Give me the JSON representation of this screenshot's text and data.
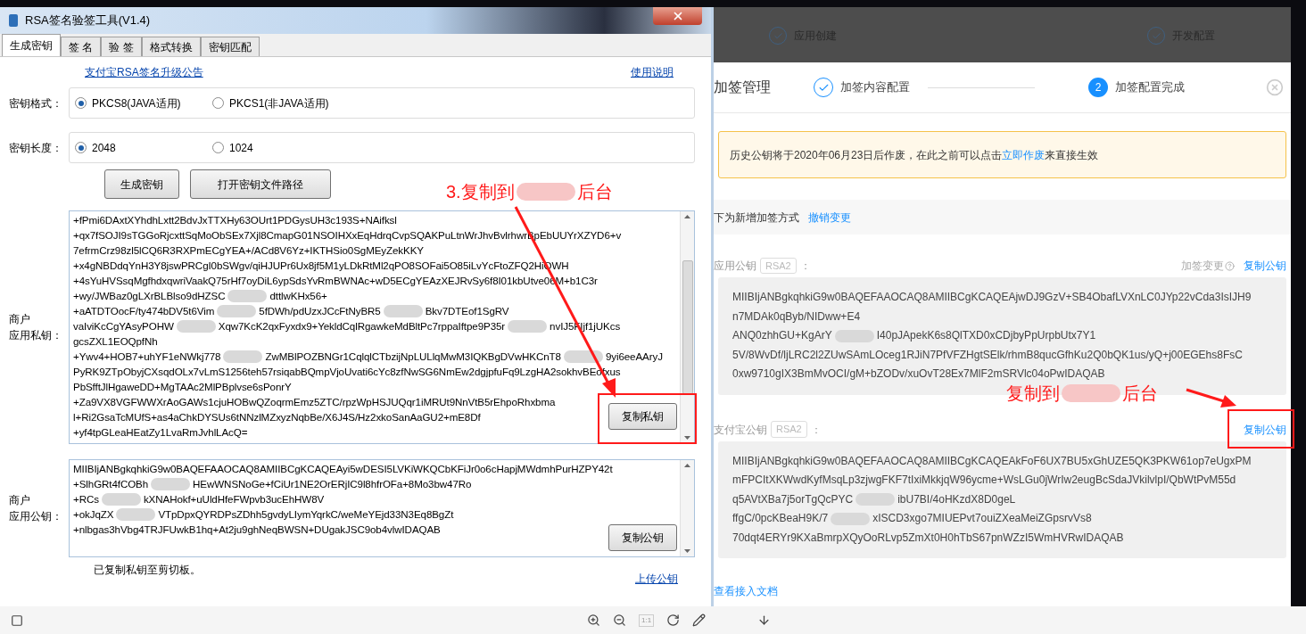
{
  "app_window": {
    "title": "RSA签名验签工具(V1.4)",
    "tabs": [
      {
        "label": "生成密钥",
        "selected": true
      },
      {
        "label": "签 名",
        "selected": false
      },
      {
        "label": "验 签",
        "selected": false
      },
      {
        "label": "格式转换",
        "selected": false
      },
      {
        "label": "密钥匹配",
        "selected": false
      }
    ],
    "links": [
      "支付宝RSA签名升级公告",
      "使用说明"
    ],
    "key_format": {
      "label": "密钥格式：",
      "options": [
        {
          "label": "PKCS8(JAVA适用)",
          "selected": true
        },
        {
          "label": "PKCS1(非JAVA适用)",
          "selected": false
        }
      ]
    },
    "key_length": {
      "label": "密钥长度：",
      "options": [
        {
          "label": "2048",
          "selected": true
        },
        {
          "label": "1024",
          "selected": false
        }
      ]
    },
    "buttons": [
      "生成密钥",
      "打开密钥文件路径"
    ],
    "private_key": {
      "label_lines": [
        "商户",
        "应用私钥："
      ],
      "button": "复制私钥",
      "lines": [
        [
          "+fPmi6DAxtXYhdhLxtt2BdvJxTTXHy63OUrt1PDGysUH3c193S+NAifksl"
        ],
        [
          "+qx7fSOJI9sTGGoRjcxttSqMoObSEx7Xjl8CmapG01NSOIHXxEqHdrqCvpSQAKPuLtnWrJhvBvlrhwrBpEbUUYrXZYD6+v"
        ],
        [
          "7efrmCrz98zl5lCQ6R3RXPmECgYEA+/ACd8V6Yz+IKTHSio0SgMEyZekKKY"
        ],
        [
          "+x4gNBDdqYnH3Y8jswPRCgI0bSWgv/qiHJUPr6Ux8jf5M1yLDkRtMl2qPO8SOFai5O85iLvYcFtoZFQ2HiQWH"
        ],
        [
          "+4sYuHVSsqMgfhdxqwriVaakQ75rHf7oyDiL6ypSdsYvRmBWNAc+wD5ECgYEAzXEJRvSy6f8I01kbUtve06M+b1C3r"
        ],
        [
          "+wy/JWBaz0gLXrBLBlso9dHZSC",
          "dttlwKHx56+"
        ],
        [
          "+aATDTOocF/ty474bDV5t6Vim",
          "5fDWh/pdUzxJCcFtNyBR5",
          "Bkv7DTEof1SgRV"
        ],
        [
          "vaIviKcCgYAsyPOHW",
          "Xqw7KcK2qxFyxdx9+YekldCqlRgawkeMdBltPc7rppaIftpe9P35r",
          "nvIJ5FIjf1jUKcs"
        ],
        [
          "gcsZXL1EOQpfNh"
        ],
        [
          "+Ywv4+HOB7+uhYF1eNWkj778",
          "ZwMBlPOZBNGr1CqlqlCTbzijNpLULlqMwM3IQKBgDVwHKCnT8",
          "9yi6eeAAryJ"
        ],
        [
          "PyRK9ZTpObyjCXsqdOLx7vLmS1256teh57rsiqabBQmpVjoUvati6cYc8zfNwSG6NmEw2dgjpfuFq9LzgHA2sokhvBEofxus"
        ],
        [
          "PbSfftJlHgaweDD+MgTAAc2MlPBplvse6sPonrY"
        ],
        [
          "+Za9VX8VGFWWXrAoGAWs1cjuHOBwQZoqrmEmz5ZTC/rpzWpHSJUQqr1iMRUt9NnVtB5rEhpoRhxbma"
        ],
        [
          "l+Ri2GsaTcMUfS+as4aChkDYSUs6tNNzlMZxyzNqbBe/X6J4S/Hz2xkoSanAaGU2+mE8Df"
        ],
        [
          "+yf4tpGLeaHEatZy1LvaRmJvhlLAcQ="
        ]
      ]
    },
    "public_key": {
      "label_lines": [
        "商户",
        "应用公钥："
      ],
      "button": "复制公钥",
      "lines": [
        [
          "MIIBIjANBgkqhkiG9w0BAQEFAAOCAQ8AMIIBCgKCAQEAyi5wDESI5LVKiWKQCbKFiJr0o6cHapjMWdmhPurHZPY42t"
        ],
        [
          "+SlhGRt4fCOBh",
          "HEwWNSNoGe+fCiUr1NE2OrERjIC9l8hfrOFa+8Mo3bw47Ro"
        ],
        [
          "+RCs",
          "kXNAHokf+uUldHfeFWpvb3ucEhHW8V"
        ],
        [
          "+okJqZX",
          "VTpDpxQYRDPsZDhh5gvdyLIymYqrkC/weMeYEjd33N3Eq8BgZt"
        ],
        [
          "+nlbgas3hVbg4TRJFUwkB1hq+At2ju9ghNeqBWSN+DUgakJSC9ob4vlwIDAQAB"
        ]
      ]
    },
    "status": "已复制私钥至剪切板。",
    "upload_link": "上传公钥"
  },
  "background_steps": [
    "应用创建",
    "开发配置"
  ],
  "modal": {
    "title": "加签管理",
    "steps": [
      {
        "label": "加签内容配置",
        "completed": true
      },
      {
        "label": "加签配置完成",
        "completed": false,
        "number": "2"
      }
    ],
    "notice": {
      "before": "历史公钥将于2020年06月23日后作废，在此之前可以点击",
      "link": "立即作废",
      "after": "来直接生效"
    },
    "change_row": {
      "text": "下为新增加签方式",
      "link": "撤销变更"
    },
    "keys": [
      {
        "label": "应用公钥",
        "badge": "RSA2",
        "colon": "：",
        "change": "加签变更",
        "copy": "复制公钥",
        "lines": [
          [
            "MIIBIjANBgkqhkiG9w0BAQEFAAOCAQ8AMIIBCgKCAQEAjwDJ9GzV+SB4ObafLVXnLC0JYp22vCda3IsIJH9"
          ],
          [
            "n7MDAk0qByb/NIDww+E4"
          ],
          [
            "ANQ0zhhGU+KgArY",
            "I40pJApekK6s8QlTXD0xCDjbyPpUrpbUtx7Y1"
          ],
          [
            "5V/8WvDf/ljLRC2l2ZUwSAmLOceg1RJiN7PfVFZHgtSElk/rhmB8qucGfhKu2Q0bQK1us/yQ+j00EGEhs8FsC"
          ],
          [
            "0xw9710gIX3BmMvOCI/gM+bZODv/xuOvT28Ex7MlF2mSRVlc04oPwIDAQAB"
          ]
        ]
      },
      {
        "label": "支付宝公钥",
        "badge": "RSA2",
        "colon": "：",
        "copy": "复制公钥",
        "lines": [
          [
            "MIIBIjANBgkqhkiG9w0BAQEFAAOCAQ8AMIIBCgKCAQEAkFoF6UX7BU5xGhUZE5QK3PKW61op7eUgxPM"
          ],
          [
            "mFPCItXKWwdKyfMsqLp3zjwgFKF7tIxiMkkjqW96ycme+WsLGu0jWrIw2eugBcSdaJVkilvlpI/QbWtPvM55d"
          ],
          [
            "q5AVtXBa7j5orTgQcPYC",
            "ibU7BI/4oHKzdX8D0geL"
          ],
          [
            "ffgC/0pcKBeaH9K/7",
            "xISCD3xgo7MIUEPvt7ouiZXeaMeiZGpsrvVs8"
          ],
          [
            "70dqt4ERYr9KXaBmrpXQyOoRLvp5ZmXt0H0hTbS67pnWZzI5WmHVRwIDAQAB"
          ]
        ]
      }
    ],
    "doc_link": "查看接入文档"
  },
  "annotations": [
    {
      "parts": [
        "3.复制到",
        "后台"
      ]
    },
    {
      "parts": [
        "复制到",
        "后台"
      ]
    }
  ],
  "viewer_toolbar": {
    "zoom_label": "1:1"
  }
}
